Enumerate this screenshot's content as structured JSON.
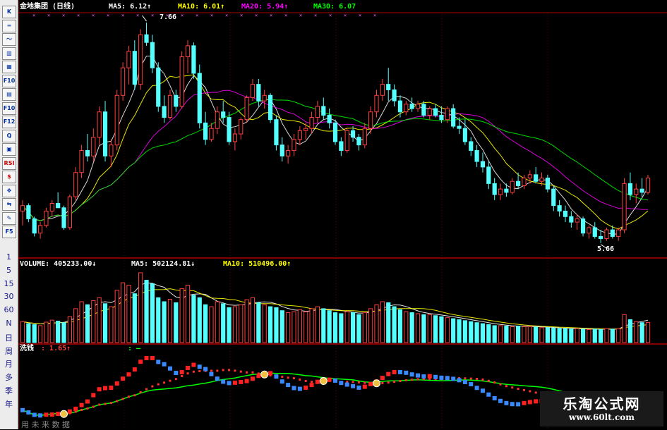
{
  "header": {
    "title": "金地集团 (日线)",
    "ma5": "MA5: 6.12↑",
    "ma10": "MA10: 6.01↑",
    "ma20": "MA20: 5.94↑",
    "ma30": "MA30: 6.07"
  },
  "annotations": {
    "high": "7.66",
    "low": "5.66"
  },
  "volume_header": {
    "volume": "VOLUME: 405233.00↓",
    "ma5": "MA5: 502124.81↓",
    "ma10": "MA10: 510496.00↑"
  },
  "indicator_header": {
    "name": "洗钱",
    "value": ": 1.65↑",
    "extra": ": —"
  },
  "toolbar": {
    "buttons": [
      "K",
      "═",
      "〜",
      "▥",
      "▦",
      "F10",
      "▤",
      "F10",
      "F12",
      "Q",
      "▣",
      "RSI",
      "$",
      "✥",
      "⇆",
      "✎",
      "F5"
    ],
    "periods": [
      "1",
      "5",
      "15",
      "30",
      "60",
      "N",
      "日",
      "周",
      "月",
      "多",
      "季",
      "年"
    ]
  },
  "footer": {
    "future_tab": "用 未 来 数 据"
  },
  "watermark": {
    "title": "乐淘公式网",
    "url": "www.60lt.com"
  },
  "colors": {
    "up": "#ff4040",
    "down": "#54ffff",
    "ma5": "#ffffff",
    "ma10": "#ffff00",
    "ma20": "#ff00ff",
    "ma30": "#00ff00",
    "grid": "#b00000"
  },
  "chart_data": {
    "type": "candlestick",
    "price": [
      [
        5.95,
        6.05,
        5.82,
        6.0
      ],
      [
        6.0,
        6.02,
        5.85,
        5.88
      ],
      [
        5.88,
        5.9,
        5.72,
        5.75
      ],
      [
        5.75,
        5.85,
        5.7,
        5.82
      ],
      [
        5.82,
        5.98,
        5.8,
        5.95
      ],
      [
        5.95,
        6.05,
        5.9,
        6.02
      ],
      [
        6.02,
        6.12,
        5.98,
        5.98
      ],
      [
        5.98,
        6.0,
        5.78,
        5.8
      ],
      [
        5.8,
        6.1,
        5.78,
        6.08
      ],
      [
        6.08,
        6.35,
        6.05,
        6.3
      ],
      [
        6.3,
        6.55,
        6.25,
        6.5
      ],
      [
        6.5,
        6.65,
        6.4,
        6.45
      ],
      [
        6.45,
        6.7,
        6.4,
        6.62
      ],
      [
        6.62,
        6.9,
        6.55,
        6.85
      ],
      [
        6.85,
        6.95,
        6.4,
        6.45
      ],
      [
        6.45,
        6.6,
        6.35,
        6.55
      ],
      [
        6.55,
        7.05,
        6.5,
        7.0
      ],
      [
        7.0,
        7.3,
        6.95,
        7.25
      ],
      [
        7.25,
        7.45,
        7.1,
        7.4
      ],
      [
        7.4,
        7.5,
        7.05,
        7.1
      ],
      [
        7.1,
        7.6,
        7.05,
        7.55
      ],
      [
        7.55,
        7.66,
        7.45,
        7.48
      ],
      [
        7.48,
        7.55,
        7.2,
        7.25
      ],
      [
        7.25,
        7.3,
        6.85,
        6.9
      ],
      [
        6.9,
        7.0,
        6.75,
        6.8
      ],
      [
        6.8,
        7.05,
        6.78,
        7.0
      ],
      [
        7.0,
        7.05,
        6.85,
        6.9
      ],
      [
        6.9,
        7.4,
        6.88,
        7.35
      ],
      [
        7.35,
        7.5,
        7.2,
        7.45
      ],
      [
        7.45,
        7.48,
        7.15,
        7.2
      ],
      [
        7.2,
        7.28,
        6.7,
        6.75
      ],
      [
        6.75,
        6.85,
        6.55,
        6.6
      ],
      [
        6.6,
        6.75,
        6.58,
        6.7
      ],
      [
        6.7,
        6.9,
        6.65,
        6.85
      ],
      [
        6.85,
        6.95,
        6.75,
        6.8
      ],
      [
        6.8,
        6.85,
        6.55,
        6.58
      ],
      [
        6.58,
        6.7,
        6.5,
        6.65
      ],
      [
        6.65,
        6.8,
        6.6,
        6.78
      ],
      [
        6.78,
        7.0,
        6.75,
        6.98
      ],
      [
        6.98,
        7.15,
        6.95,
        7.1
      ],
      [
        7.1,
        7.15,
        6.9,
        6.95
      ],
      [
        6.95,
        7.05,
        6.88,
        7.0
      ],
      [
        7.0,
        7.02,
        6.75,
        6.78
      ],
      [
        6.78,
        6.82,
        6.5,
        6.55
      ],
      [
        6.55,
        6.62,
        6.4,
        6.45
      ],
      [
        6.45,
        6.55,
        6.38,
        6.5
      ],
      [
        6.5,
        6.65,
        6.45,
        6.6
      ],
      [
        6.6,
        6.72,
        6.55,
        6.68
      ],
      [
        6.68,
        6.75,
        6.6,
        6.7
      ],
      [
        6.7,
        6.85,
        6.65,
        6.8
      ],
      [
        6.8,
        6.95,
        6.75,
        6.9
      ],
      [
        6.9,
        6.98,
        6.78,
        6.82
      ],
      [
        6.82,
        6.88,
        6.7,
        6.75
      ],
      [
        6.75,
        6.78,
        6.55,
        6.58
      ],
      [
        6.58,
        6.62,
        6.45,
        6.5
      ],
      [
        6.5,
        6.7,
        6.48,
        6.68
      ],
      [
        6.68,
        6.72,
        6.58,
        6.62
      ],
      [
        6.62,
        6.65,
        6.5,
        6.55
      ],
      [
        6.55,
        6.75,
        6.52,
        6.7
      ],
      [
        6.7,
        6.9,
        6.65,
        6.85
      ],
      [
        6.85,
        7.05,
        6.8,
        7.0
      ],
      [
        7.0,
        7.15,
        6.95,
        7.1
      ],
      [
        7.1,
        7.25,
        6.95,
        7.05
      ],
      [
        7.05,
        7.1,
        6.9,
        6.95
      ],
      [
        6.95,
        7.0,
        6.8,
        6.85
      ],
      [
        6.85,
        6.95,
        6.82,
        6.92
      ],
      [
        6.92,
        6.98,
        6.85,
        6.88
      ],
      [
        6.88,
        6.95,
        6.85,
        6.92
      ],
      [
        6.92,
        6.95,
        6.8,
        6.82
      ],
      [
        6.82,
        6.9,
        6.78,
        6.88
      ],
      [
        6.88,
        6.92,
        6.8,
        6.82
      ],
      [
        6.82,
        6.9,
        6.75,
        6.78
      ],
      [
        6.78,
        6.9,
        6.75,
        6.88
      ],
      [
        6.88,
        6.92,
        6.7,
        6.72
      ],
      [
        6.72,
        6.8,
        6.65,
        6.7
      ],
      [
        6.7,
        6.78,
        6.55,
        6.58
      ],
      [
        6.58,
        6.62,
        6.45,
        6.5
      ],
      [
        6.5,
        6.55,
        6.35,
        6.4
      ],
      [
        6.4,
        6.48,
        6.3,
        6.35
      ],
      [
        6.35,
        6.4,
        6.15,
        6.2
      ],
      [
        6.2,
        6.25,
        6.05,
        6.1
      ],
      [
        6.1,
        6.2,
        6.05,
        6.15
      ],
      [
        6.15,
        6.2,
        6.08,
        6.12
      ],
      [
        6.12,
        6.25,
        6.1,
        6.22
      ],
      [
        6.22,
        6.3,
        6.15,
        6.18
      ],
      [
        6.18,
        6.28,
        6.15,
        6.25
      ],
      [
        6.25,
        6.32,
        6.2,
        6.28
      ],
      [
        6.28,
        6.35,
        6.2,
        6.22
      ],
      [
        6.22,
        6.3,
        6.18,
        6.25
      ],
      [
        6.25,
        6.28,
        6.12,
        6.15
      ],
      [
        6.15,
        6.18,
        5.95,
        6.0
      ],
      [
        6.0,
        6.05,
        5.9,
        5.95
      ],
      [
        5.95,
        6.0,
        5.85,
        5.9
      ],
      [
        5.9,
        5.95,
        5.8,
        5.85
      ],
      [
        5.85,
        5.92,
        5.78,
        5.88
      ],
      [
        5.88,
        5.9,
        5.72,
        5.75
      ],
      [
        5.75,
        5.82,
        5.7,
        5.8
      ],
      [
        5.8,
        5.85,
        5.7,
        5.72
      ],
      [
        5.72,
        5.78,
        5.66,
        5.7
      ],
      [
        5.7,
        5.8,
        5.68,
        5.78
      ],
      [
        5.78,
        5.82,
        5.7,
        5.72
      ],
      [
        5.72,
        5.8,
        5.68,
        5.78
      ],
      [
        5.78,
        6.25,
        5.75,
        6.2
      ],
      [
        6.2,
        6.3,
        6.05,
        6.1
      ],
      [
        6.1,
        6.2,
        6.02,
        6.15
      ],
      [
        6.15,
        6.25,
        6.08,
        6.12
      ],
      [
        6.12,
        6.28,
        6.1,
        6.25
      ]
    ],
    "volume": [
      420,
      380,
      360,
      340,
      410,
      450,
      430,
      400,
      520,
      680,
      820,
      760,
      840,
      900,
      780,
      720,
      1050,
      1200,
      1150,
      980,
      1400,
      1250,
      1180,
      900,
      820,
      870,
      800,
      1080,
      1150,
      950,
      900,
      760,
      720,
      820,
      780,
      700,
      720,
      760,
      860,
      900,
      800,
      760,
      720,
      700,
      640,
      600,
      620,
      660,
      620,
      680,
      720,
      680,
      640,
      600,
      580,
      620,
      600,
      560,
      600,
      680,
      760,
      820,
      800,
      720,
      660,
      620,
      600,
      580,
      560,
      560,
      540,
      520,
      500,
      480,
      460,
      440,
      420,
      400,
      380,
      360,
      340,
      340,
      330,
      320,
      330,
      320,
      320,
      310,
      300,
      300,
      290,
      280,
      280,
      270,
      280,
      270,
      260,
      270,
      260,
      280,
      270,
      280,
      560,
      460,
      420,
      400,
      405
    ],
    "indicator": {
      "name": "洗钱",
      "value": 1.65
    },
    "ylim_price": [
      5.55,
      7.75
    ]
  }
}
